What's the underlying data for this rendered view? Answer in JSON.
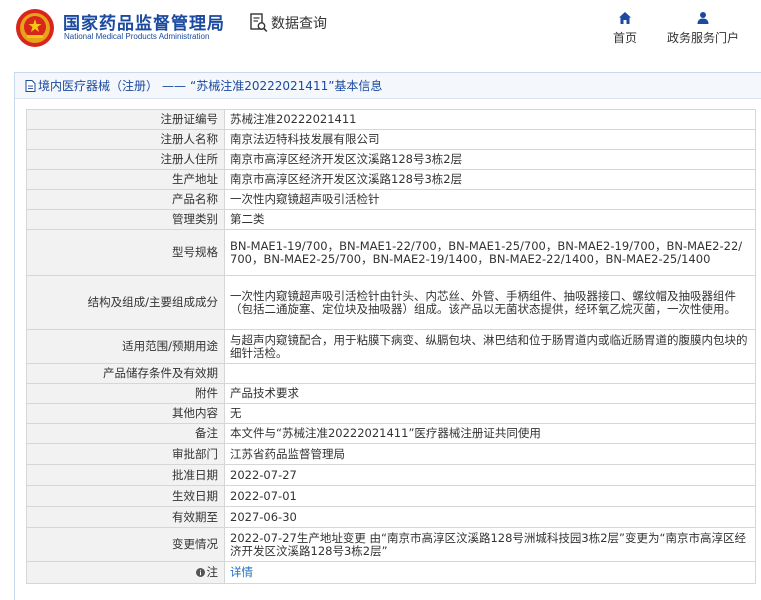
{
  "header": {
    "site_title_cn": "国家药品监督管理局",
    "site_title_en": "National Medical Products Administration",
    "page_heading": "数据查询",
    "nav": [
      {
        "label": "首页",
        "icon": "home-icon"
      },
      {
        "label": "政务服务门户",
        "icon": "user-icon"
      }
    ],
    "brand_color": "#1b4aa0",
    "logo_color": "#d9261c"
  },
  "panel": {
    "category": "境内医疗器械（注册）",
    "separator": "——",
    "subject": "“苏械注准20222021411”基本信息"
  },
  "rows": [
    {
      "label": "注册证编号",
      "value": "苏械注准20222021411"
    },
    {
      "label": "注册人名称",
      "value": "南京法迈特科技发展有限公司"
    },
    {
      "label": "注册人住所",
      "value": "南京市高淳区经济开发区汶溪路128号3栋2层"
    },
    {
      "label": "生产地址",
      "value": "南京市高淳区经济开发区汶溪路128号3栋2层"
    },
    {
      "label": "产品名称",
      "value": "一次性内窥镜超声吸引活检针"
    },
    {
      "label": "管理类别",
      "value": "第二类"
    },
    {
      "label": "型号规格",
      "value": "BN-MAE1-19/700，BN-MAE1-22/700，BN-MAE1-25/700，BN-MAE2-19/700，BN-MAE2-22/700，BN-MAE2-25/700，BN-MAE2-19/1400，BN-MAE2-22/1400，BN-MAE2-25/1400"
    },
    {
      "label": "结构及组成/主要组成成分",
      "value": "一次性内窥镜超声吸引活检针由针头、内芯丝、外管、手柄组件、抽吸器接口、螺纹帽及抽吸器组件（包括二通旋塞、定位块及抽吸器）组成。该产品以无菌状态提供，经环氧乙烷灭菌，一次性使用。"
    },
    {
      "label": "适用范围/预期用途",
      "value": "与超声内窥镜配合，用于粘膜下病变、纵膈包块、淋巴结和位于肠胃道内或临近肠胃道的腹膜内包块的细针活检。"
    },
    {
      "label": "产品储存条件及有效期",
      "value": ""
    },
    {
      "label": "附件",
      "value": "产品技术要求"
    },
    {
      "label": "其他内容",
      "value": "无"
    },
    {
      "label": "备注",
      "value": "本文件与“苏械注准20222021411”医疗器械注册证共同使用"
    },
    {
      "label": "审批部门",
      "value": "江苏省药品监督管理局"
    },
    {
      "label": "批准日期",
      "value": "2022-07-27"
    },
    {
      "label": "生效日期",
      "value": "2022-07-01"
    },
    {
      "label": "有效期至",
      "value": "2027-06-30"
    },
    {
      "label": "变更情况",
      "value": "2022-07-27生产地址变更 由“南京市高淳区汶溪路128号洲城科技园3栋2层”变更为“南京市高淳区经济开发区汶溪路128号3栋2层”"
    }
  ],
  "note_row": {
    "label": "注",
    "link": "详情",
    "icon": "info-icon"
  }
}
